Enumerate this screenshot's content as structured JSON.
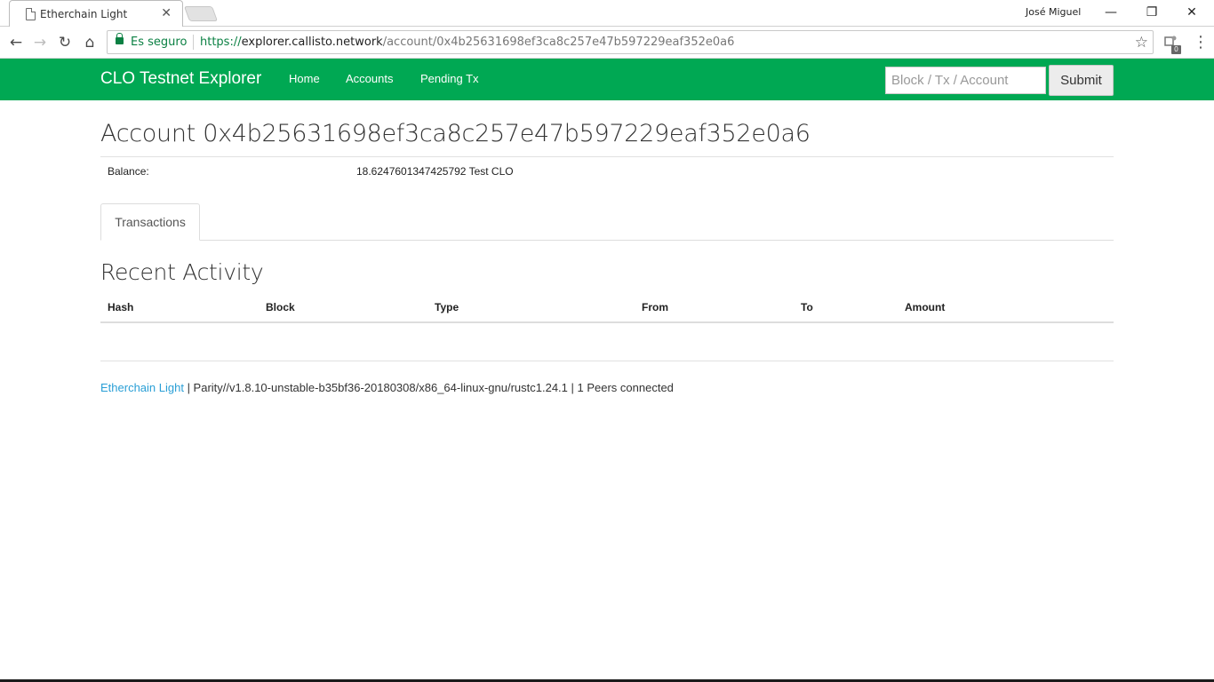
{
  "browser": {
    "tab_title": "Etherchain Light",
    "tab_close": "✕",
    "profile_name": "José Miguel",
    "window_buttons": {
      "minimize": "—",
      "maximize": "❐",
      "close": "✕"
    },
    "nav": {
      "back": "←",
      "forward": "→",
      "reload": "↻",
      "home": "⌂"
    },
    "secure_label": "Es seguro",
    "url": {
      "scheme": "https://",
      "host": "explorer.callisto.network",
      "path": "/account/0x4b25631698ef3ca8c257e47b597229eaf352e0a6"
    },
    "star": "☆",
    "extension_badge": "0",
    "menu": "⋮"
  },
  "site": {
    "brand": "CLO Testnet Explorer",
    "nav_links": {
      "home": "Home",
      "accounts": "Accounts",
      "pending": "Pending Tx"
    },
    "search_placeholder": "Block / Tx / Account",
    "submit_label": "Submit"
  },
  "account": {
    "title": "Account 0x4b25631698ef3ca8c257e47b597229eaf352e0a6",
    "balance_label": "Balance:",
    "balance_value": "18.6247601347425792 Test CLO"
  },
  "tabs": {
    "transactions": "Transactions"
  },
  "activity": {
    "title": "Recent Activity",
    "columns": {
      "hash": "Hash",
      "block": "Block",
      "type": "Type",
      "from": "From",
      "to": "To",
      "amount": "Amount"
    },
    "rows": []
  },
  "footer": {
    "link": "Etherchain Light",
    "text": " | Parity//v1.8.10-unstable-b35bf36-20180308/x86_64-linux-gnu/rustc1.24.1 | 1 Peers connected"
  },
  "colors": {
    "navbar": "#00a853",
    "secure_green": "#0b8043",
    "link_blue": "#2a9fd6"
  }
}
